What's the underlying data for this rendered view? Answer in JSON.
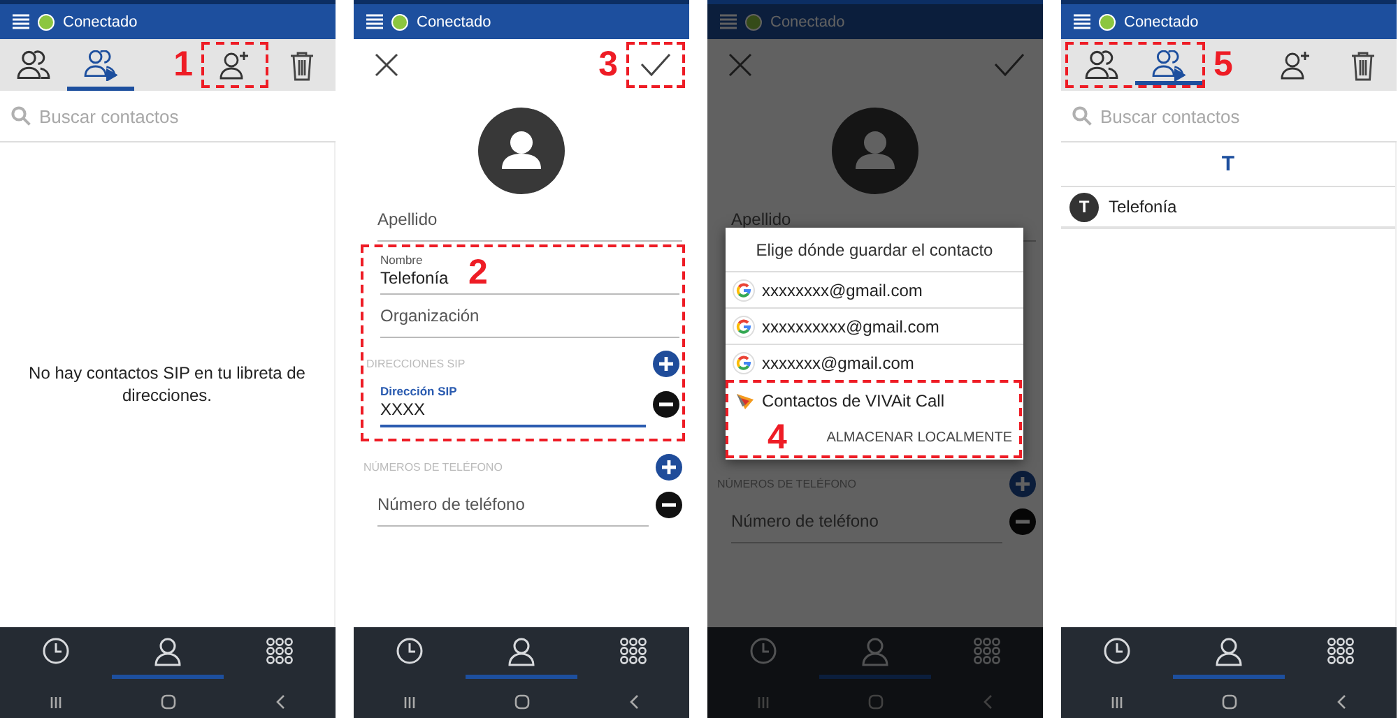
{
  "screens": [
    {
      "kind": "list",
      "status_bar": {
        "text": "Conectado"
      },
      "tabs": [
        {
          "kind": "contacts",
          "selected": false
        },
        {
          "kind": "sip_contacts",
          "selected": true
        }
      ],
      "annotation": {
        "label": "1",
        "frames_add_button": true,
        "frames_tabs": false
      },
      "search": {
        "placeholder": "Buscar contactos"
      },
      "empty_message": "No hay contactos SIP en tu libreta de direcciones.",
      "bottom_nav": [
        {
          "kind": "history",
          "selected": false
        },
        {
          "kind": "contacts",
          "selected": true
        },
        {
          "kind": "dialpad",
          "selected": false
        }
      ]
    },
    {
      "kind": "edit",
      "status_bar": {
        "text": "Conectado"
      },
      "annotation": {
        "label": "3"
      },
      "fields": [
        {
          "kind": "field",
          "placeholder": "Apellido",
          "focused": false,
          "removable": false
        },
        {
          "kind": "annotated_group",
          "label": "2",
          "children": [
            {
              "kind": "field",
              "label": "Nombre",
              "value": "Telefonía",
              "focused": false,
              "removable": false
            },
            {
              "kind": "field",
              "placeholder": "Organización",
              "focused": false,
              "removable": false
            },
            {
              "kind": "section",
              "label": "DIRECCIONES SIP"
            },
            {
              "kind": "field",
              "label": "Dirección SIP",
              "value": "XXXX",
              "focused": true,
              "removable": true
            }
          ]
        },
        {
          "kind": "section",
          "label": "NÚMEROS DE TELÉFONO"
        },
        {
          "kind": "field",
          "placeholder": "Número de teléfono",
          "focused": false,
          "removable": true
        }
      ],
      "bottom_nav": [
        {
          "kind": "history",
          "selected": false
        },
        {
          "kind": "contacts",
          "selected": true
        },
        {
          "kind": "dialpad",
          "selected": false
        }
      ]
    },
    {
      "kind": "edit",
      "status_bar": {
        "text": "Conectado"
      },
      "dimmed": true,
      "fields": [
        {
          "kind": "field",
          "placeholder": "Apellido",
          "focused": false,
          "removable": false
        },
        {
          "kind": "section",
          "label": "NÚMEROS DE TELÉFONO"
        },
        {
          "kind": "field",
          "placeholder": "Número de teléfono",
          "focused": false,
          "removable": true
        }
      ],
      "dialog": {
        "title": "Elige dónde guardar el contacto",
        "options": [
          {
            "kind": "google",
            "label": "xxxxxxxx@gmail.com"
          },
          {
            "kind": "google",
            "label": "xxxxxxxxxx@gmail.com"
          },
          {
            "kind": "google",
            "label": "xxxxxxx@gmail.com"
          }
        ],
        "annotation": {
          "label": "4",
          "option": {
            "kind": "app",
            "label": "Contactos de VIVAit Call"
          },
          "action": "ALMACENAR LOCALMENTE"
        }
      },
      "bottom_nav": [
        {
          "kind": "history",
          "selected": false
        },
        {
          "kind": "contacts",
          "selected": true
        },
        {
          "kind": "dialpad",
          "selected": false
        }
      ]
    },
    {
      "kind": "list",
      "status_bar": {
        "text": "Conectado"
      },
      "tabs": [
        {
          "kind": "contacts",
          "selected": false
        },
        {
          "kind": "sip_contacts",
          "selected": true
        }
      ],
      "annotation": {
        "label": "5",
        "frames_add_button": false,
        "frames_tabs": true
      },
      "search": {
        "placeholder": "Buscar contactos"
      },
      "contacts": {
        "index": "T",
        "items": [
          {
            "initial": "T",
            "name": "Telefonía"
          }
        ]
      },
      "bottom_nav": [
        {
          "kind": "history",
          "selected": false
        },
        {
          "kind": "contacts",
          "selected": true
        },
        {
          "kind": "dialpad",
          "selected": false
        }
      ]
    }
  ]
}
